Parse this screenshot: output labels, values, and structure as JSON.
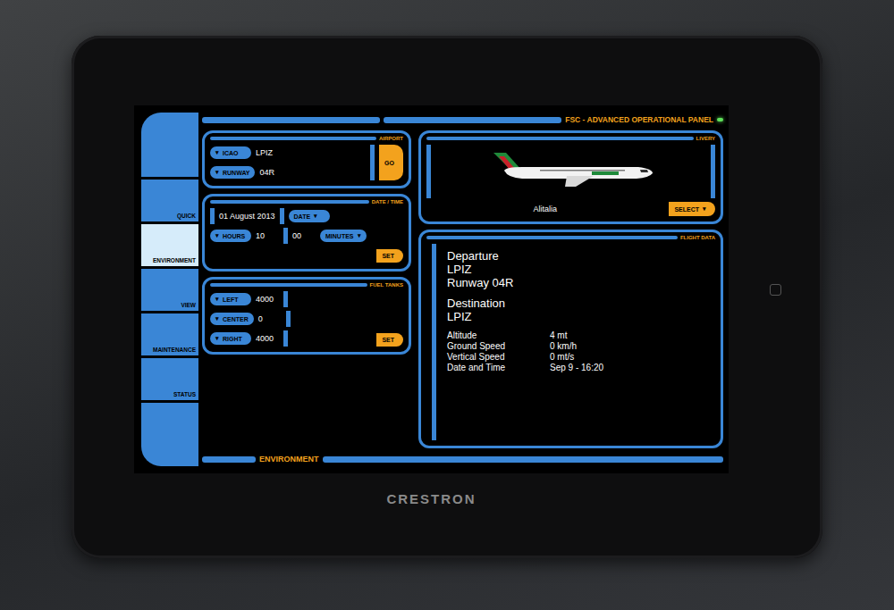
{
  "device": {
    "brand": "CRESTRON",
    "status_led": {
      "on": true
    }
  },
  "header": {
    "title": "FSC - ADVANCED OPERATIONAL PANEL"
  },
  "sidebar": {
    "items": [
      {
        "label": "QUICK",
        "selected": false
      },
      {
        "label": "ENVIRONMENT",
        "selected": true
      },
      {
        "label": "VIEW",
        "selected": false
      },
      {
        "label": "MAINTENANCE",
        "selected": false
      },
      {
        "label": "STATUS",
        "selected": false
      }
    ]
  },
  "airport": {
    "title": "AIRPORT",
    "fields": [
      {
        "arrow": "▾",
        "label": "ICAO",
        "value": "LPIZ"
      },
      {
        "arrow": "▾",
        "label": "RUNWAY",
        "value": "04R"
      }
    ],
    "button": "GO"
  },
  "datetime": {
    "title": "DATE / TIME",
    "date": "01 August 2013",
    "date_button": {
      "label": "DATE",
      "arrow": "▾"
    },
    "hours_button": {
      "arrow": "▾",
      "label": "HOURS"
    },
    "hours": "10",
    "minutes": "00",
    "minutes_button": {
      "label": "MINUTES",
      "arrow": "▾"
    },
    "button": "SET"
  },
  "fuel": {
    "title": "FUEL TANKS",
    "tanks": [
      {
        "arrow": "▾",
        "label": "LEFT",
        "value": "4000"
      },
      {
        "arrow": "▾",
        "label": "CENTER",
        "value": "0"
      },
      {
        "arrow": "▾",
        "label": "RIGHT",
        "value": "4000"
      }
    ],
    "button": "SET"
  },
  "livery": {
    "title": "LIVERY",
    "name": "Alitalia",
    "button": "SELECT",
    "arrow": "▾"
  },
  "flight_data": {
    "title": "FLIGHT DATA",
    "departure": {
      "heading": "Departure",
      "airport": "LPIZ",
      "runway": "Runway 04R"
    },
    "destination": {
      "heading": "Destination",
      "airport": "LPIZ"
    },
    "readings": [
      {
        "label": "Altitude",
        "value": "4 mt"
      },
      {
        "label": "Ground Speed",
        "value": "0 km/h"
      },
      {
        "label": "Vertical Speed",
        "value": "0 mt/s"
      },
      {
        "label": "Date and Time",
        "value": "Sep 9 - 16:20"
      }
    ]
  },
  "footer": {
    "label": "ENVIRONMENT"
  }
}
